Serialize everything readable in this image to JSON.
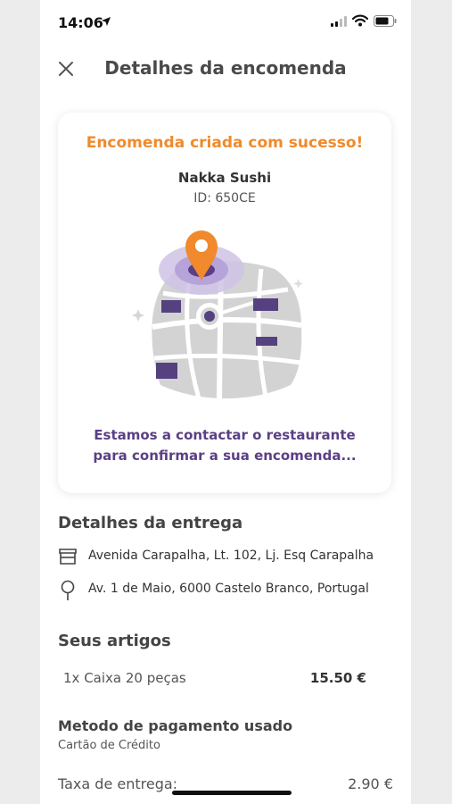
{
  "status": {
    "time": "14:06"
  },
  "header": {
    "title": "Detalhes da encomenda"
  },
  "card": {
    "success_message": "Encomenda criada com sucesso!",
    "restaurant_name": "Nakka Sushi",
    "order_id": "ID: 650CE",
    "contact_message": "Estamos a contactar o restaurante para confirmar a sua encomenda..."
  },
  "delivery": {
    "title": "Detalhes da entrega",
    "restaurant_address": "Avenida Carapalha, Lt. 102, Lj. Esq Carapalha",
    "customer_address": "Av. 1 de Maio, 6000 Castelo Branco, Portugal"
  },
  "items": {
    "title": "Seus artigos",
    "list": [
      {
        "description": "1x Caixa 20 peças",
        "price": "15.50 €"
      }
    ]
  },
  "payment": {
    "title": "Metodo de pagamento usado",
    "method": "Cartão de Crédito"
  },
  "fees": {
    "delivery_label": "Taxa de entrega:",
    "delivery_value": "2.90 €"
  },
  "colors": {
    "accent_orange": "#f08a2c",
    "accent_purple": "#5b3f86"
  },
  "icons": {
    "close": "close-icon",
    "store": "store-icon",
    "location": "map-pin-icon",
    "illustration": "map-illustration"
  }
}
